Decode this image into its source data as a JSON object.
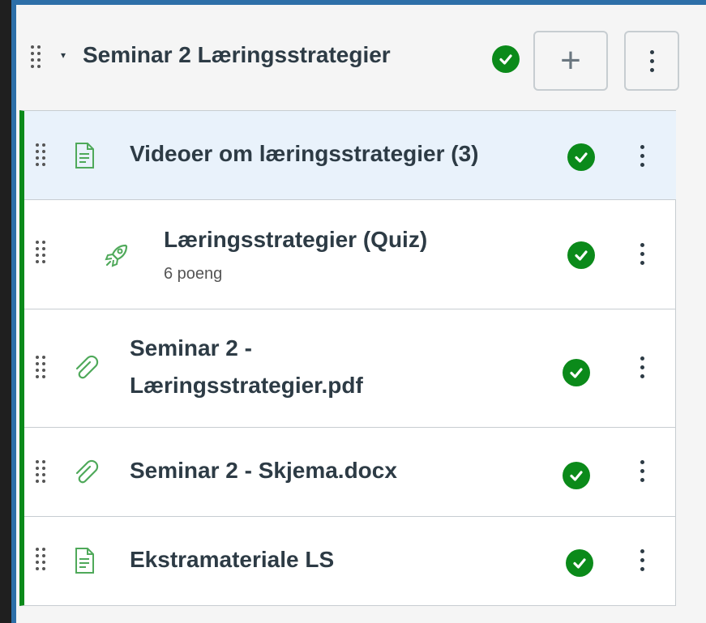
{
  "module": {
    "title": "Seminar 2 Læringsstrategier",
    "toggle_glyph": "▾",
    "add_glyph": "+",
    "published_icon": "check-circle-icon"
  },
  "items": [
    {
      "title": "Videoer om læringsstrategier (3)",
      "type_icon": "document-icon",
      "selected": true
    },
    {
      "title": "Læringsstrategier (Quiz)",
      "subtitle": "6 poeng",
      "type_icon": "rocket-icon",
      "indented": true
    },
    {
      "title_line1": "Seminar 2 -",
      "title_line2": "Læringsstrategier.pdf",
      "type_icon": "paperclip-icon"
    },
    {
      "title": "Seminar 2 - Skjema.docx",
      "type_icon": "paperclip-icon"
    },
    {
      "title": "Ekstramateriale LS",
      "type_icon": "document-icon"
    }
  ],
  "colors": {
    "accent_green": "#0b8a1a",
    "icon_green": "#4fa95a",
    "selected_row": "#e9f2fb",
    "text": "#2d3b45"
  }
}
